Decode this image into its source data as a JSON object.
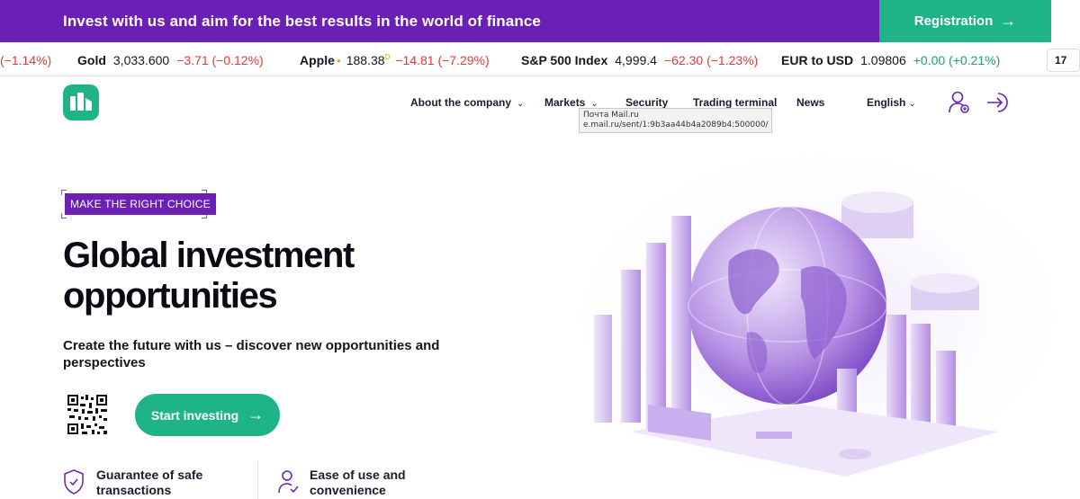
{
  "promo": {
    "text": "Invest with us and aim for the best results in the world of finance",
    "registration_label": "Registration"
  },
  "ticker": {
    "first_change": "(−1.14%)",
    "items": [
      {
        "name": "Gold",
        "price": "3,033.600",
        "change": "−3.71 (−0.12%)"
      },
      {
        "name": "Apple",
        "price": "188.38",
        "price_suffix": "D",
        "change": "−14.81 (−7.29%)"
      },
      {
        "name": "S&P 500 Index",
        "price": "4,999.4",
        "change": "−62.30 (−1.23%)"
      },
      {
        "name": "EUR to USD",
        "price": "1.09806",
        "change": "+0.00 (+0.21%)"
      }
    ],
    "widget_label": "17"
  },
  "nav": {
    "about": "About the company",
    "markets": "Markets",
    "security": "Security",
    "terminal": "Trading terminal",
    "news": "News",
    "language": "English"
  },
  "tooltip": {
    "line1": "Почта Mail.ru",
    "line2": "e.mail.ru/sent/1:9b3aa44b4a2089b4:500000/"
  },
  "hero": {
    "tag": "MAKE THE RIGHT CHOICE",
    "title_line1": "Global investment",
    "title_line2": "opportunities",
    "subtitle": "Create the future with us – discover new opportunities and perspectives",
    "start_label": "Start investing"
  },
  "features": [
    {
      "line1": "Guarantee of safe",
      "line2": "transactions"
    },
    {
      "line1": "Ease of use and",
      "line2": "convenience"
    }
  ],
  "colors": {
    "brand_purple": "#6a1fb5",
    "brand_green": "#1fb487",
    "negative": "#e53935",
    "positive": "#22a06b"
  }
}
